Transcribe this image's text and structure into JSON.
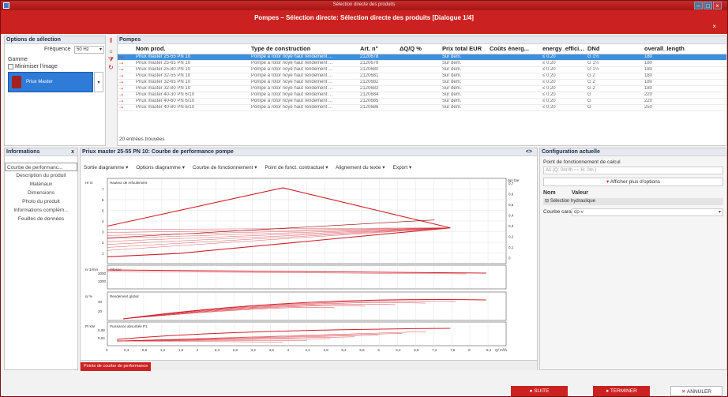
{
  "window": {
    "title": "Sélection directe des produits"
  },
  "dialog_title": "Pompes – Sélection directe: Sélection directe des produits [Dialogue 1/4]",
  "selection": {
    "header": "Options de sélection",
    "freq_label": "Fréquence",
    "freq_value": "50 Hz",
    "gamme_label": "Gamme",
    "minimize_label": "Minimiser l'image",
    "product": "Priux Master"
  },
  "pumps": {
    "header": "Pompes",
    "columns": [
      "Nom prod.",
      "Type de construction",
      "Art. n°",
      "ΔQ/Q %",
      "Prix total EUR",
      "Coûts énerg...",
      "energy_effici...",
      "DNd",
      "overall_length"
    ],
    "rows": [
      [
        "Priux master 25-55 PN 10",
        "Pompe à rotor noyé haut rendement ...",
        "2120678",
        "",
        "Sur dem.",
        "",
        "≤ 0.20",
        "G 1½",
        "180"
      ],
      [
        "Priux master 25-65 PN 10",
        "Pompe à rotor noyé haut rendement ...",
        "2120679",
        "",
        "Sur dem.",
        "",
        "≤ 0.20",
        "G 1½",
        "180"
      ],
      [
        "Priux master 25-80 PN 10",
        "Pompe à rotor noyé haut rendement ...",
        "2120680",
        "",
        "Sur dem.",
        "",
        "≤ 0.20",
        "G 1½",
        "180"
      ],
      [
        "Priux master 32-55 PN 10",
        "Pompe à rotor noyé haut rendement ...",
        "2120681",
        "",
        "Sur dem.",
        "",
        "≤ 0.20",
        "G 2",
        "180"
      ],
      [
        "Priux master 32-65 PN 10",
        "Pompe à rotor noyé haut rendement ...",
        "2120682",
        "",
        "Sur dem.",
        "",
        "≤ 0.20",
        "G 2",
        "180"
      ],
      [
        "Priux master 32-80 PN 10",
        "Pompe à rotor noyé haut rendement ...",
        "2120683",
        "",
        "Sur dem.",
        "",
        "≤ 0.20",
        "G 2",
        "180"
      ],
      [
        "Priux master 40-30 PN 6/10",
        "Pompe à rotor noyé haut rendement ...",
        "2120684",
        "",
        "Sur dem.",
        "",
        "≤ 0.20",
        "G",
        "220"
      ],
      [
        "Priux master 40-60 PN 6/10",
        "Pompe à rotor noyé haut rendement ...",
        "2120685",
        "",
        "Sur dem.",
        "",
        "≤ 0.20",
        "G",
        "220"
      ],
      [
        "Priux master 40-80 PN 6/10",
        "Pompe à rotor noyé haut rendement ...",
        "2120686",
        "",
        "Sur dem.",
        "",
        "≤ 0.20",
        "G",
        "250"
      ]
    ],
    "count": "20 entrées trouvées"
  },
  "info": {
    "header": "Informations",
    "items": [
      "Courbe de performanc...",
      "Description du produit",
      "Matériaux",
      "Dimensions",
      "Photo du produit",
      "Informations complém...",
      "Feuilles de données"
    ]
  },
  "chart": {
    "title": "Priux master 25-55 PN 10: Courbe de performance pompe",
    "menus": [
      "Sortie diagramme",
      "Options diagramme",
      "Courbe de fonctionnement",
      "Point de fonct. contractuel",
      "Alignement du texte",
      "Export"
    ],
    "tab": "Points de courbe de performance"
  },
  "config": {
    "header": "Configuration actuelle",
    "point_label": "Point de fonctionnement de calcul",
    "point_value": "A1 (Q: 0m³/h ~~ H: 0m )",
    "more_options": "Afficher plus d'options",
    "col_name": "Nom",
    "col_value": "Valeur",
    "group": "Sélection hydraulique",
    "curve_label": "Courbe caracté...",
    "curve_value": "dp-v"
  },
  "buttons": {
    "next": "SUITE",
    "finish": "TERMINER",
    "cancel": "ANNULER"
  },
  "chart_data": [
    {
      "type": "line",
      "title": "",
      "ylabel": "H/ m",
      "y_right_label": "Δp/ bar",
      "annotation": "Hauteur de refoulement",
      "ylim": [
        0,
        8
      ],
      "y_ticks": [
        1,
        2,
        3,
        4,
        5,
        6,
        7
      ],
      "y_right_ticks": [
        "0,7",
        "0,6",
        "0,5",
        "0,4",
        "0,3",
        "0,2",
        "0,1",
        "0"
      ]
    },
    {
      "type": "line",
      "ylabel": "n/ 1/min",
      "annotation": "Vitesse",
      "y_ticks": [
        1000,
        2000
      ]
    },
    {
      "type": "line",
      "ylabel": "η/ %",
      "annotation": "Rendement global",
      "y_ticks": [
        20,
        40
      ]
    },
    {
      "type": "line",
      "ylabel": "P/ kW",
      "annotation": "Puissance absorbée P1",
      "y_ticks": [
        "0,04",
        "0,08"
      ],
      "xlabel": "Q/ m³/h",
      "x_ticks": [
        "0",
        "0,4",
        "0,8",
        "1,2",
        "1,6",
        "2",
        "2,4",
        "2,8",
        "3,2",
        "3,6",
        "4",
        "4,4",
        "4,8",
        "5,2",
        "5,6",
        "6",
        "6,4",
        "6,8",
        "7,2",
        "7,6",
        "8",
        "8,4"
      ]
    }
  ]
}
